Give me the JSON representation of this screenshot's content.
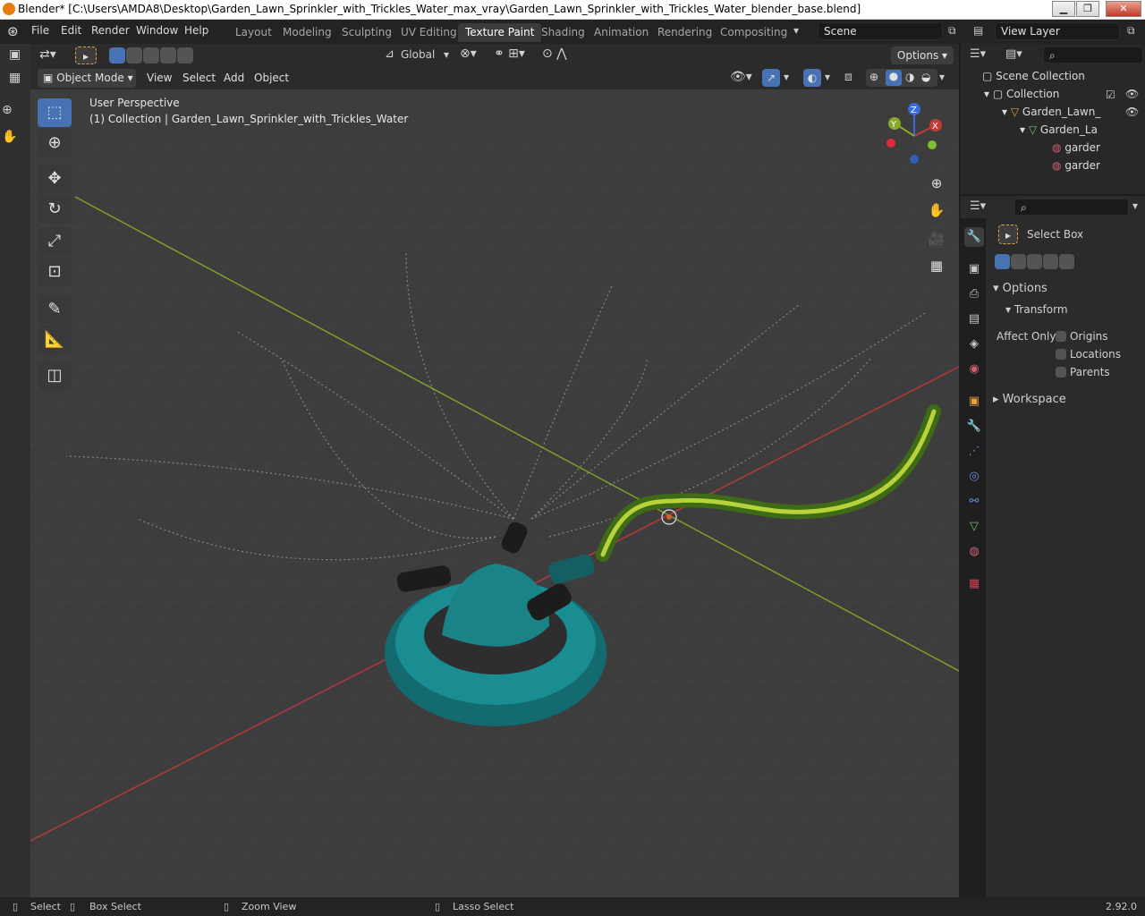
{
  "window": {
    "title": "Blender* [C:\\Users\\AMDA8\\Desktop\\Garden_Lawn_Sprinkler_with_Trickles_Water_max_vray\\Garden_Lawn_Sprinkler_with_Trickles_Water_blender_base.blend]",
    "minimize": "▁",
    "maximize": "❐",
    "close": "✕"
  },
  "menus": {
    "file": "File",
    "edit": "Edit",
    "render": "Render",
    "window": "Window",
    "help": "Help"
  },
  "workspaces": [
    "Layout",
    "Modeling",
    "Sculpting",
    "UV Editing",
    "Texture Paint",
    "Shading",
    "Animation",
    "Rendering",
    "Compositing"
  ],
  "active_workspace": "Texture Paint",
  "scene": "Scene",
  "view_layer": "View Layer",
  "header": {
    "orientation": "Global",
    "options": "Options",
    "mode": "Object Mode",
    "view": "View",
    "select": "Select",
    "add": "Add",
    "object": "Object"
  },
  "viewport": {
    "perspective": "User Perspective",
    "collection_info": "(1) Collection | Garden_Lawn_Sprinkler_with_Trickles_Water",
    "gizmo": {
      "x": "X",
      "y": "Y",
      "z": "Z"
    }
  },
  "outliner": {
    "scene_collection": "Scene Collection",
    "collection": "Collection",
    "object": "Garden_Lawn_",
    "mesh": "Garden_La",
    "material1": "garder",
    "material2": "garder"
  },
  "properties": {
    "tool": "Select Box",
    "options": "Options",
    "transform": "Transform",
    "affect_only": "Affect Only",
    "origins": "Origins",
    "locations": "Locations",
    "parents": "Parents",
    "workspace": "Workspace"
  },
  "status": {
    "select": "Select",
    "box_select": "Box Select",
    "zoom_view": "Zoom View",
    "lasso_select": "Lasso Select",
    "version": "2.92.0"
  },
  "colors": {
    "accent": "#4772b3",
    "sprinkler": "#1a7f82",
    "hose": "#6aa82a",
    "x_axis": "#c23a3a",
    "y_axis": "#7f9f2a"
  }
}
